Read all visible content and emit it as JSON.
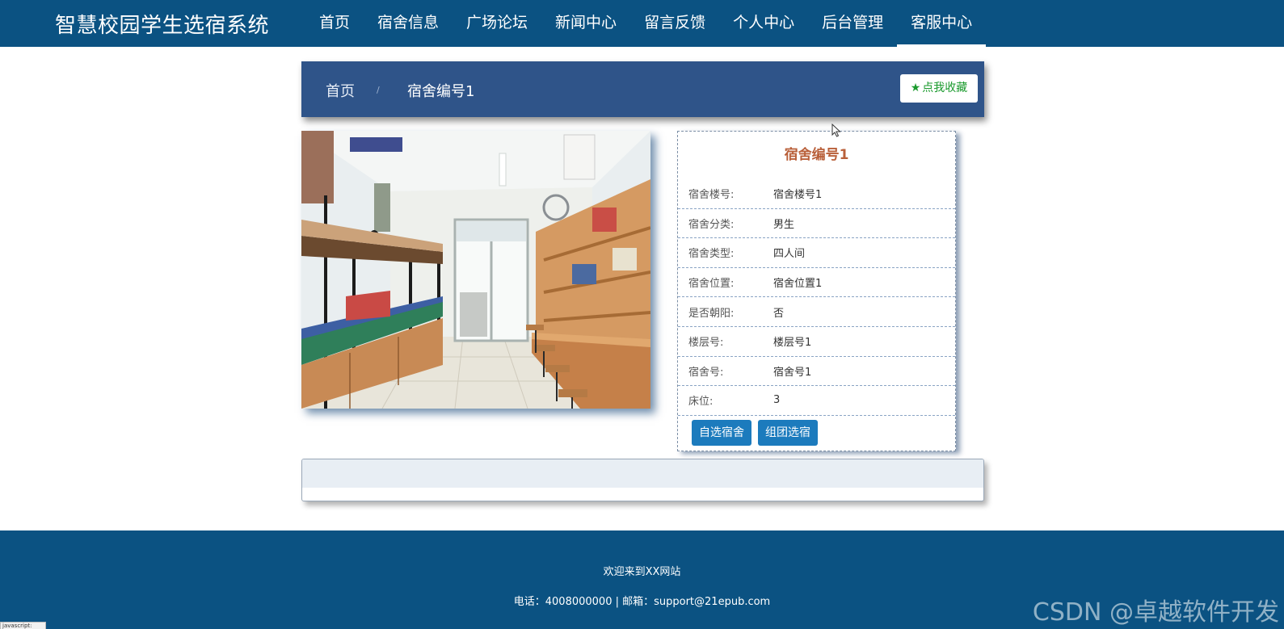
{
  "header": {
    "site_title": "智慧校园学生选宿系统",
    "nav": [
      {
        "label": "首页"
      },
      {
        "label": "宿舍信息"
      },
      {
        "label": "广场论坛"
      },
      {
        "label": "新闻中心"
      },
      {
        "label": "留言反馈"
      },
      {
        "label": "个人中心"
      },
      {
        "label": "后台管理"
      },
      {
        "label": "客服中心",
        "active": true
      }
    ]
  },
  "breadcrumb": {
    "home": "首页",
    "separator": "/",
    "current": "宿舍编号1",
    "favorite_button": "点我收藏",
    "favorite_icon": "star-icon"
  },
  "detail": {
    "title": "宿舍编号1",
    "fields": [
      {
        "label": "宿舍楼号:",
        "value": "宿舍楼号1"
      },
      {
        "label": "宿舍分类:",
        "value": "男生"
      },
      {
        "label": "宿舍类型:",
        "value": "四人间"
      },
      {
        "label": "宿舍位置:",
        "value": "宿舍位置1"
      },
      {
        "label": "是否朝阳:",
        "value": "否"
      },
      {
        "label": "楼层号:",
        "value": "楼层号1"
      },
      {
        "label": "宿舍号:",
        "value": "宿舍号1"
      },
      {
        "label": "床位:",
        "value": "3"
      }
    ],
    "buttons": {
      "self_select": "自选宿舍",
      "group_select": "组团选宿"
    }
  },
  "footer": {
    "welcome": "欢迎来到XX网站",
    "contact": "电话：4008000000 | 邮箱：support@21epub.com",
    "watermark": "CSDN @卓越软件开发",
    "status_text": "javascript:"
  },
  "colors": {
    "nav_bg": "#0b5282",
    "breadcrumb_bg": "#2f5489",
    "title_color": "#b9603a",
    "button_bg": "#1c7bbd",
    "favorite_color": "#1a9a2d"
  }
}
